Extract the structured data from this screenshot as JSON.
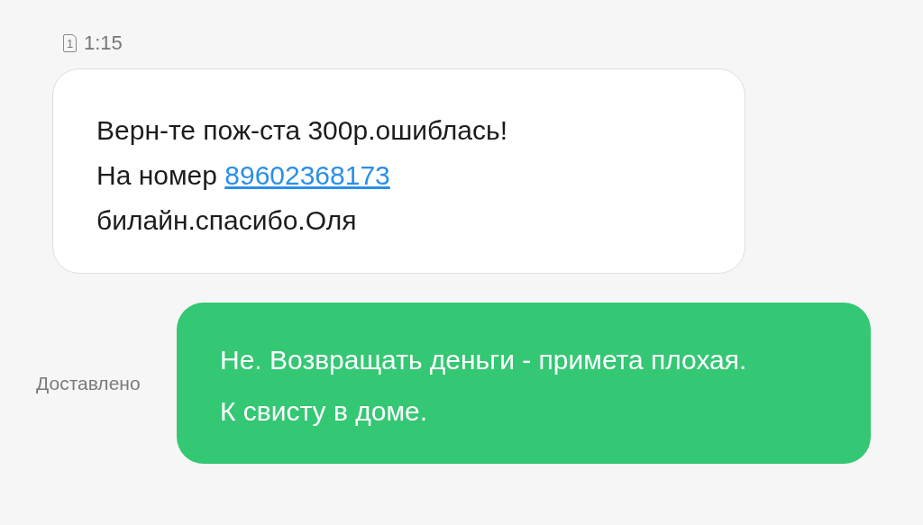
{
  "header": {
    "sim_slot": "1",
    "time": "1:15"
  },
  "incoming": {
    "segments": [
      {
        "kind": "text",
        "text": "Верн-те пож-ста 300р.ошиблась!\nНа номер "
      },
      {
        "kind": "link",
        "text": "89602368173"
      },
      {
        "kind": "text",
        "text": "\nбилайн.спасибо.Оля"
      }
    ]
  },
  "outgoing": {
    "status": "Доставлено",
    "text": "Не. Возвращать деньги - примета плохая. К свисту в доме."
  }
}
